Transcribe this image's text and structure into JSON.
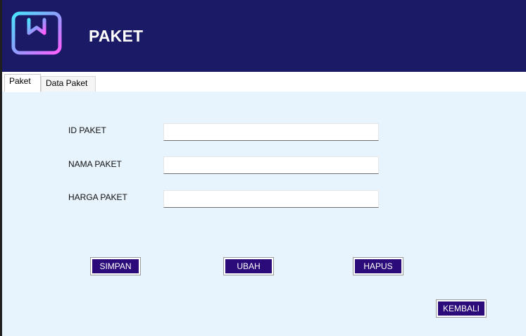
{
  "header": {
    "title": "PAKET",
    "background": "#1b1a66",
    "logo_icon": "package-bookmark-icon"
  },
  "tabs": [
    {
      "label": "Paket",
      "active": true
    },
    {
      "label": "Data Paket",
      "active": false
    }
  ],
  "form": {
    "id_paket": {
      "label": "ID PAKET",
      "value": "",
      "placeholder": ""
    },
    "nama_paket": {
      "label": "NAMA PAKET",
      "value": "",
      "placeholder": ""
    },
    "harga_paket": {
      "label": "HARGA PAKET",
      "value": "",
      "placeholder": ""
    }
  },
  "actions": {
    "simpan_label": "SIMPAN",
    "ubah_label": "UBAH",
    "hapus_label": "HAPUS",
    "kembali_label": "KEMBALI",
    "button_color": "#2b0b7a"
  },
  "colors": {
    "content_background": "#e8f4fd",
    "header_text": "#ffffff"
  }
}
